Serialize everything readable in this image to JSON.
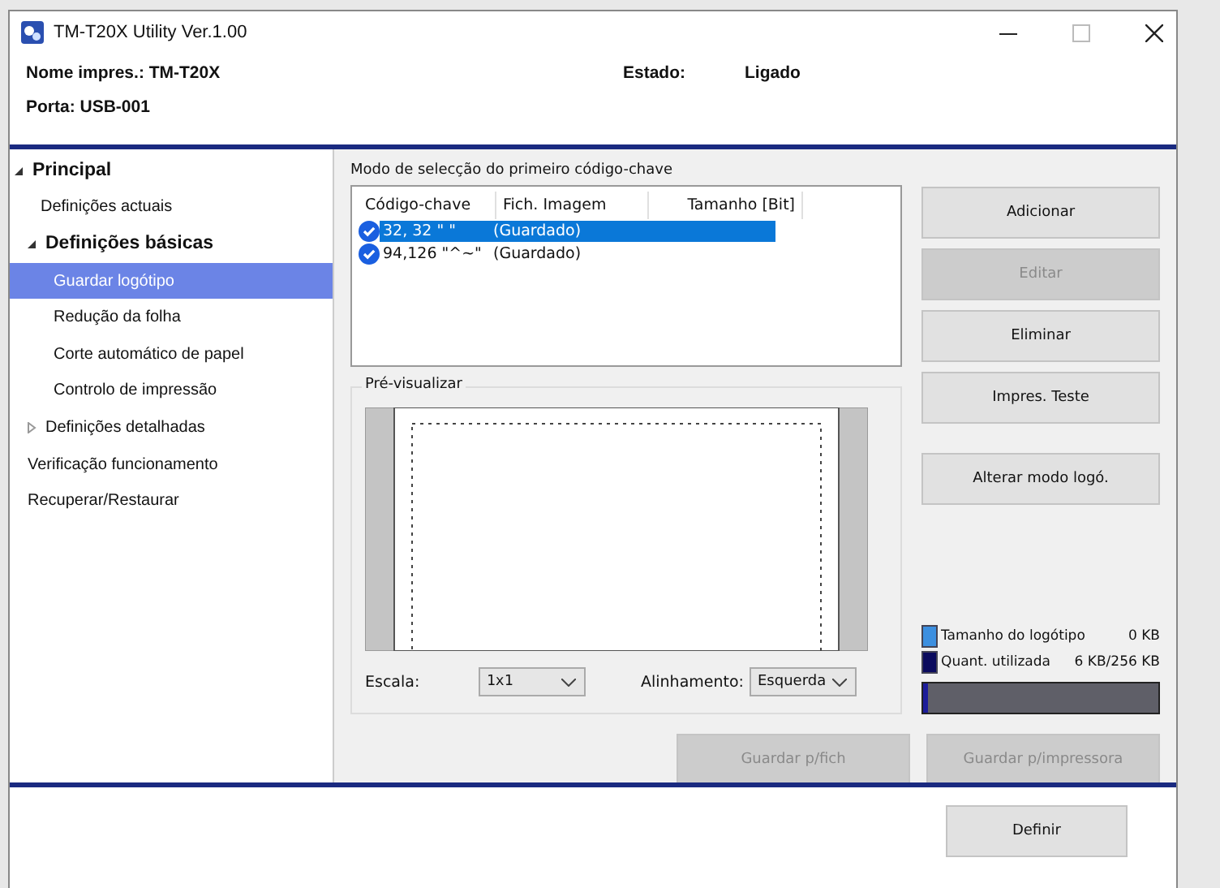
{
  "window": {
    "title": "TM-T20X Utility Ver.1.00"
  },
  "header": {
    "printer": "Nome impres.: TM-T20X",
    "port": "Porta: USB-001",
    "status_label": "Estado:",
    "status_value": "Ligado"
  },
  "sidebar": {
    "items": [
      {
        "label": "Principal",
        "kind": "heading",
        "expanded": true,
        "selected": false,
        "children": [
          {
            "label": "Definições actuais",
            "selected": false
          },
          {
            "label": "Definições básicas",
            "kind": "heading",
            "expanded": true,
            "selected": false,
            "children": [
              {
                "label": "Guardar logótipo",
                "selected": true
              },
              {
                "label": "Redução da folha",
                "selected": false
              },
              {
                "label": "Corte automático de papel",
                "selected": false
              },
              {
                "label": "Controlo de impressão",
                "selected": false
              }
            ]
          },
          {
            "label": "Definições detalhadas",
            "expanded": false,
            "selected": false
          }
        ]
      },
      {
        "label": "Verificação funcionamento",
        "selected": false
      },
      {
        "label": "Recuperar/Restaurar",
        "selected": false
      }
    ]
  },
  "keycodes": {
    "title": "Modo de selecção do primeiro código-chave",
    "columns": [
      "Código-chave",
      "Fich. Imagem",
      "Tamanho [Bit]"
    ],
    "rows": [
      {
        "key": "32, 32  \" \"",
        "image": "(Guardado)",
        "checked": true,
        "selected": true
      },
      {
        "key": "94,126  \"^~\"",
        "image": "(Guardado)",
        "checked": true,
        "selected": false
      }
    ]
  },
  "preview": {
    "title": "Pré-visualizar",
    "scale_label": "Escala:",
    "scale": "1x1",
    "align_label": "Alinhamento:",
    "align": "Esquerda"
  },
  "actions": [
    {
      "label": "Adicionar",
      "disabled": false
    },
    {
      "label": "Editar",
      "disabled": true
    },
    {
      "label": "Eliminar",
      "disabled": false
    },
    {
      "label": "Impres. Teste",
      "disabled": false
    },
    {
      "label": "Alterar modo logó.",
      "disabled": false
    }
  ],
  "memory": {
    "legend": [
      {
        "label": "Tamanho do logótipo",
        "value": "0 KB",
        "color": "#3c8fe0"
      },
      {
        "label": "Quant. utilizada",
        "value": "6 KB/256 KB",
        "color": "#0a0a5e"
      }
    ],
    "level": 0.02
  },
  "save_buttons": [
    {
      "label": "Guardar p/fich",
      "disabled": true
    },
    {
      "label": "Guardar p/impressora",
      "disabled": true
    }
  ],
  "footer": {
    "button": "Definir"
  }
}
